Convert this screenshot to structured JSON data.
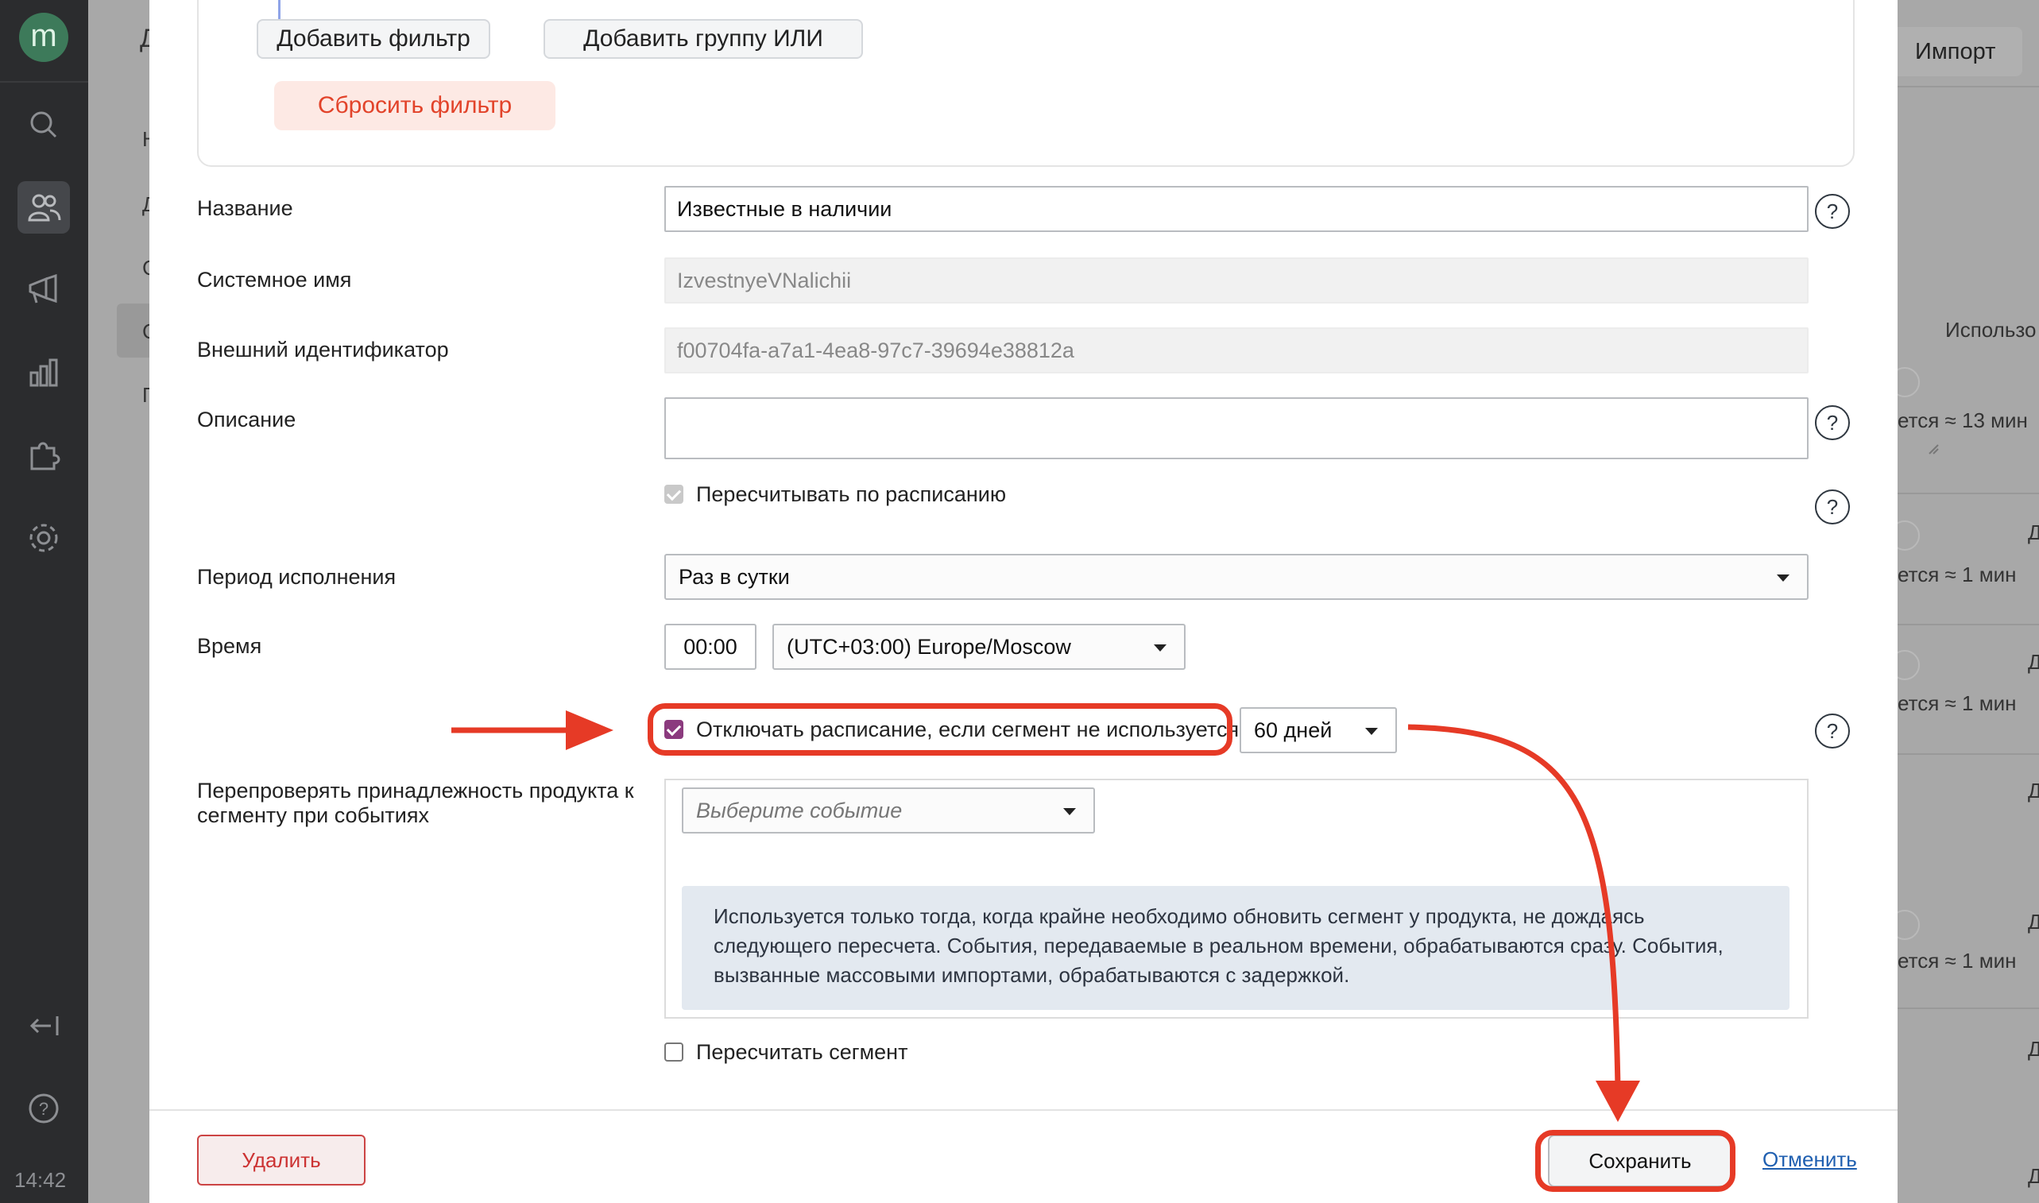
{
  "sidebar": {
    "logo": "m",
    "icons": [
      "search-icon",
      "users-icon",
      "megaphone-icon",
      "chart-icon",
      "puzzle-icon",
      "gear-icon",
      "collapse-icon",
      "help-icon"
    ],
    "time": "14:42"
  },
  "background": {
    "header_letter": "Д",
    "import_button": "Импорт",
    "column_header": "Использо",
    "nav_letters": [
      "Н",
      "Д",
      "С",
      "С",
      "П"
    ],
    "rows": [
      {
        "duration": "ется ≈ 13 мин"
      },
      {
        "duration": "ется ≈ 1 мин"
      },
      {
        "duration": "ется ≈ 1 мин"
      },
      {
        "duration": "ется ≈ 1 мин"
      }
    ],
    "right_letter": "Д"
  },
  "filter": {
    "add_filter": "Добавить фильтр",
    "add_or_group": "Добавить группу ИЛИ",
    "reset_filter": "Сбросить фильтр"
  },
  "form": {
    "name_label": "Название",
    "name_value": "Известные в наличии",
    "system_name_label": "Системное имя",
    "system_name_value": "IzvestnyeVNalichii",
    "external_id_label": "Внешний идентификатор",
    "external_id_value": "f00704fa-a7a1-4ea8-97c7-39694e38812a",
    "description_label": "Описание",
    "description_value": "",
    "recalc_schedule_label": "Пересчитывать по расписанию",
    "recalc_schedule_checked": true,
    "period_label": "Период исполнения",
    "period_value": "Раз в сутки",
    "time_label": "Время",
    "time_value": "00:00",
    "timezone_value": "(UTC+03:00) Europe/Moscow",
    "disable_schedule_label": "Отключать расписание, если сегмент не используется",
    "disable_schedule_checked": true,
    "disable_days_value": "60 дней",
    "recheck_label_line1": "Перепроверять принадлежность продукта к",
    "recheck_label_line2": "сегменту при событиях",
    "event_placeholder": "Выберите событие",
    "info_line1": "Используется только тогда, когда крайне необходимо обновить сегмент у продукта, не дождаясь",
    "info_line2": "следующего пересчета. События, передаваемые в реальном времени, обрабатываются сразу. События,",
    "info_line3": "вызванные массовыми импортами, обрабатываются с задержкой.",
    "recalc_segment_label": "Пересчитать сегмент",
    "recalc_segment_checked": false,
    "help_symbol": "?"
  },
  "footer": {
    "delete": "Удалить",
    "save": "Сохранить",
    "cancel": "Отменить"
  },
  "colors": {
    "annotation": "#e63a26",
    "checkbox_accent": "#8b3a7e",
    "link": "#1f5fb0"
  }
}
